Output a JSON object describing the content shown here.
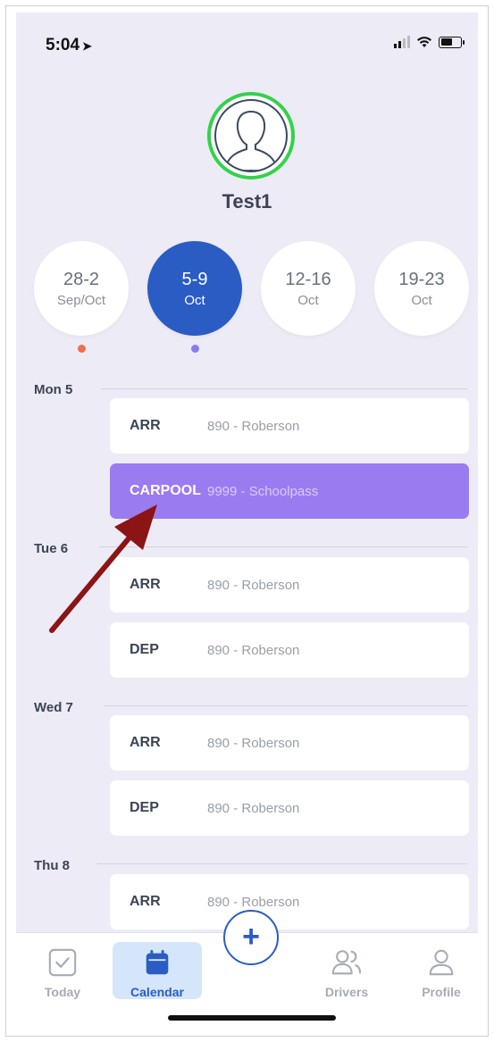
{
  "status_bar": {
    "time": "5:04",
    "location_glyph": "➤"
  },
  "profile": {
    "name": "Test1"
  },
  "weeks": [
    {
      "range": "28-2",
      "month": "Sep/Oct",
      "dot_color": "#f07048"
    },
    {
      "range": "5-9",
      "month": "Oct",
      "dot_color": "#8a7cf0",
      "active": true
    },
    {
      "range": "12-16",
      "month": "Oct"
    },
    {
      "range": "19-23",
      "month": "Oct"
    }
  ],
  "days": [
    {
      "label": "Mon 5",
      "entries": [
        {
          "type": "ARR",
          "desc": "890 - Roberson"
        },
        {
          "type": "CARPOOL",
          "desc": "9999 - Schoolpass",
          "highlight": true
        }
      ]
    },
    {
      "label": "Tue 6",
      "entries": [
        {
          "type": "ARR",
          "desc": "890 - Roberson"
        },
        {
          "type": "DEP",
          "desc": "890 - Roberson"
        }
      ]
    },
    {
      "label": "Wed 7",
      "entries": [
        {
          "type": "ARR",
          "desc": "890 - Roberson"
        },
        {
          "type": "DEP",
          "desc": "890 - Roberson"
        }
      ]
    },
    {
      "label": "Thu 8",
      "entries": [
        {
          "type": "ARR",
          "desc": "890 - Roberson"
        }
      ]
    }
  ],
  "tabs": {
    "today": "Today",
    "calendar": "Calendar",
    "add": "+",
    "drivers": "Drivers",
    "profile": "Profile"
  },
  "colors": {
    "accent": "#2a5cc4",
    "carpool": "#9b7bf0",
    "avatar_ring": "#33d24a",
    "annotation_arrow": "#8b1414"
  }
}
